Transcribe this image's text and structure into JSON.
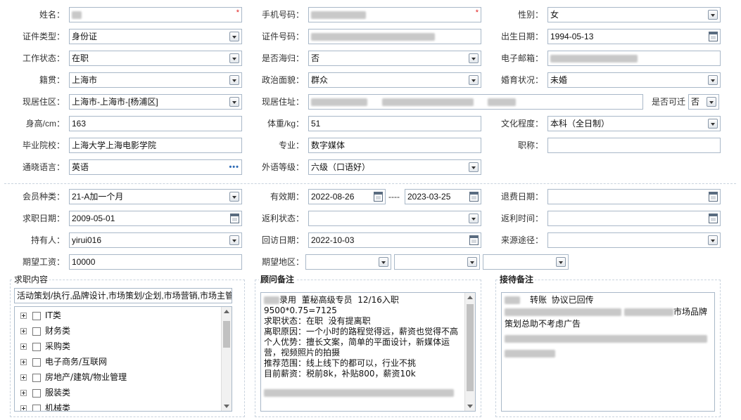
{
  "form": {
    "name_label": "姓名：",
    "phone_label": "手机号码：",
    "gender_label": "性别：",
    "gender_value": "女",
    "id_type_label": "证件类型：",
    "id_type_value": "身份证",
    "id_number_label": "证件号码：",
    "birth_label": "出生日期：",
    "birth_value": "1994-05-13",
    "work_status_label": "工作状态：",
    "work_status_value": "在职",
    "overseas_label": "是否海归：",
    "overseas_value": "否",
    "email_label": "电子邮箱：",
    "native_label": "籍贯：",
    "native_value": "上海市",
    "political_label": "政治面貌：",
    "political_value": "群众",
    "marital_label": "婚育状况：",
    "marital_value": "未婚",
    "residence_label": "现居住区：",
    "residence_value": "上海市-上海市-[杨浦区]",
    "address_label": "现居住址：",
    "relocate_label": "是否可迁",
    "relocate_value": "否",
    "height_label": "身高/cm：",
    "height_value": "163",
    "weight_label": "体重/kg：",
    "weight_value": "51",
    "education_label": "文化程度：",
    "education_value": "本科（全日制）",
    "school_label": "毕业院校：",
    "school_value": "上海大学上海电影学院",
    "major_label": "专业：",
    "major_value": "数字媒体",
    "title_label": "职称：",
    "title_value": "",
    "language_label": "通晓语言：",
    "language_value": "英语",
    "lang_level_label": "外语等级：",
    "lang_level_value": "六级（口语好）",
    "required_mark": "*",
    "more_mark": "•••"
  },
  "member": {
    "type_label": "会员种类：",
    "type_value": "21-A加一个月",
    "valid_label": "有效期：",
    "valid_from": "2022-08-26",
    "valid_sep": "----",
    "valid_to": "2023-03-25",
    "refund_date_label": "退费日期：",
    "refund_date_value": "",
    "job_date_label": "求职日期：",
    "job_date_value": "2009-05-01",
    "rebate_status_label": "返利状态：",
    "rebate_status_value": "",
    "rebate_time_label": "返利时间：",
    "rebate_time_value": "",
    "holder_label": "持有人：",
    "holder_value": "yirui016",
    "visit_date_label": "回访日期：",
    "visit_date_value": "2022-10-03",
    "source_label": "来源途径：",
    "source_value": "",
    "salary_label": "期望工资：",
    "salary_value": "10000",
    "region_label": "期望地区："
  },
  "job_content": {
    "title": "求职内容",
    "summary": "活动策划/执行,品牌设计,市场策划/企划,市场营销,市场主管",
    "categories": [
      "IT类",
      "财务类",
      "采购类",
      "电子商务/互联网",
      "房地产/建筑/物业管理",
      "服装类",
      "机械类"
    ]
  },
  "advisor_note": {
    "title": "顾问备注",
    "lines": [
      "录用  董秘高级专员  12/16入职",
      "9500*0.75=7125",
      "",
      "求职状态：在职  没有提离职",
      "离职原因：一个小时的路程觉得远，薪资也觉得不高",
      "个人优势：擅长文案，简单的平面设计，新媒体运",
      "营，视频照片的拍摄",
      "推荐范围：线上线下的都可以，行业不挑",
      "目前薪资：税前8k，补贴800，薪资10k"
    ]
  },
  "reception_note": {
    "title": "接待备注",
    "line1": "转账  协议已回传",
    "line2": "市场品牌",
    "line3": "策划总助不考虑广告"
  },
  "colors": {
    "border": "#a9b8c8",
    "required": "#e02020",
    "link": "#2e6bb5"
  }
}
